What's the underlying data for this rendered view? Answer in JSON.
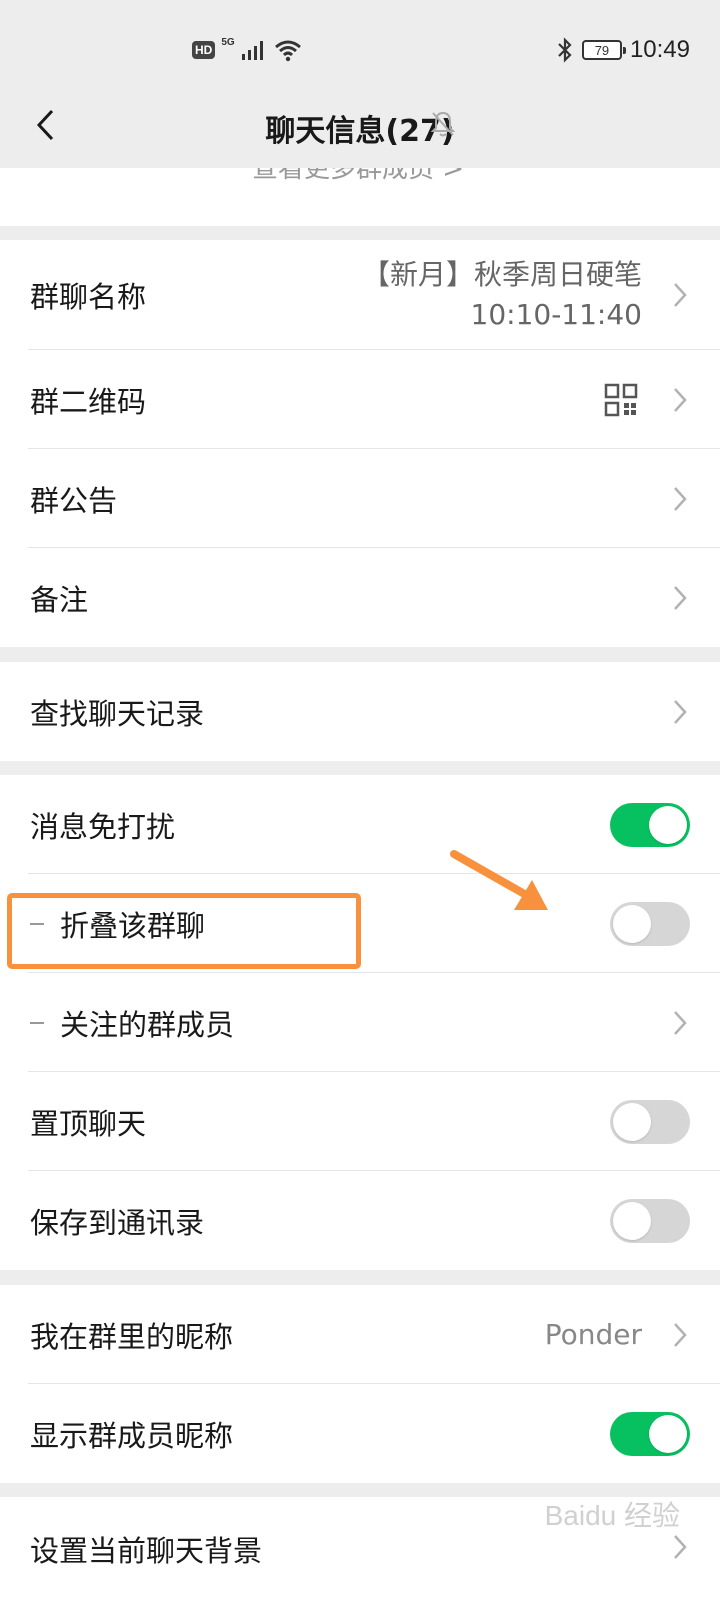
{
  "status_bar": {
    "hd": "HD",
    "network": "5G",
    "battery": "79",
    "time": "10:49",
    "icons": [
      "signal-icon",
      "wifi-icon",
      "bluetooth-icon",
      "battery-icon"
    ]
  },
  "header": {
    "title": "聊天信息(27)",
    "back_icon": "chevron-left-icon",
    "mute_icon": "muted-bell-icon"
  },
  "members": {
    "more_link": "查看更多群成员 >"
  },
  "group_info": {
    "items": [
      {
        "label": "群聊名称",
        "value_line1": "【新月】秋季周日硬笔",
        "value_line2": "10:10-11:40"
      },
      {
        "label": "群二维码"
      },
      {
        "label": "群公告"
      },
      {
        "label": "备注"
      }
    ]
  },
  "search": {
    "label": "查找聊天记录"
  },
  "settings": {
    "items": [
      {
        "label": "消息免打扰",
        "toggle": "on"
      },
      {
        "label": "折叠该群聊",
        "toggle": "off"
      },
      {
        "label": "关注的群成员"
      },
      {
        "label": "置顶聊天",
        "toggle": "off"
      },
      {
        "label": "保存到通讯录",
        "toggle": "off"
      }
    ]
  },
  "nickname": {
    "items": [
      {
        "label": "我在群里的昵称",
        "value": "Ponder"
      },
      {
        "label": "显示群成员昵称",
        "toggle": "on"
      }
    ]
  },
  "background": {
    "label": "设置当前聊天背景"
  },
  "watermark": "Baidu 经验",
  "colors": {
    "accent_green": "#07c160",
    "highlight_orange": "#f7913d",
    "background": "#ededed"
  }
}
